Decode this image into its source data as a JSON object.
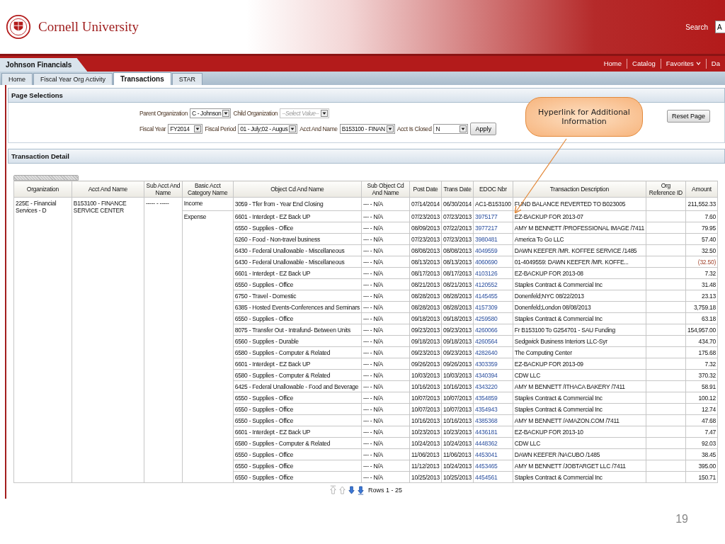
{
  "header": {
    "university": "Cornell University",
    "search_label": "Search",
    "search_value": "A"
  },
  "app_bar": {
    "title": "Johnson Financials",
    "links": [
      {
        "label": "Home",
        "has_menu": false
      },
      {
        "label": "Catalog",
        "has_menu": false
      },
      {
        "label": "Favorites",
        "has_menu": true
      },
      {
        "label": "Da",
        "has_menu": false
      }
    ]
  },
  "tabs": [
    {
      "label": "Home",
      "selected": false
    },
    {
      "label": "Fiscal Year Org Activity",
      "selected": false
    },
    {
      "label": "Transactions",
      "selected": true
    },
    {
      "label": "STAR",
      "selected": false
    }
  ],
  "page_selections": {
    "title": "Page Selections",
    "rows": [
      [
        {
          "label": "Parent Organization",
          "value": "C - Johnson",
          "disabled": false
        },
        {
          "label": "Child Organization",
          "placeholder": "--Select Value--",
          "disabled": true
        }
      ],
      [
        {
          "label": "Fiscal Year",
          "value": "FY2014",
          "disabled": false
        },
        {
          "label": "Fiscal Period",
          "value": "01 - July;02 - Augus",
          "disabled": false
        },
        {
          "label": "Acct And Name",
          "value": "B153100 - FINAN",
          "disabled": false
        },
        {
          "label": "Acct Is Closed",
          "value": "N",
          "disabled": false
        }
      ]
    ],
    "apply": "Apply",
    "reset": "Reset Page"
  },
  "callout": {
    "text": "Hyperlink for Additional Information"
  },
  "transaction_detail": {
    "title": "Transaction Detail",
    "columns": [
      "Organization",
      "Acct And Name",
      "Sub Acct And Name",
      "Basic Acct Category Name",
      "Object Cd And Name",
      "Sub Object Cd And Name",
      "Post Date",
      "Trans Date",
      "EDOC Nbr",
      "Transaction Description",
      "Org Reference ID",
      "Amount"
    ],
    "organization": "225E - Financial Services - D",
    "acct": "B153100 - FINANCE SERVICE CENTER",
    "sub_acct": "----- - -----",
    "groups": [
      {
        "category": "Income",
        "rows": [
          {
            "object": "3059 - Tfer from - Year End Closing",
            "sub_object": "--- - N/A",
            "post_date": "07/14/2014",
            "trans_date": "06/30/2014",
            "edoc": "AC1-B153100",
            "edoc_link": false,
            "description": "FUND BALANCE REVERTED TO B023005",
            "amount": "211,552.33",
            "negative": false
          }
        ]
      },
      {
        "category": "Expense",
        "rows": [
          {
            "object": "6601 - Interdept - EZ Back UP",
            "sub_object": "--- - N/A",
            "post_date": "07/23/2013",
            "trans_date": "07/23/2013",
            "edoc": "3975177",
            "edoc_link": true,
            "description": "EZ-BACKUP FOR 2013-07",
            "amount": "7.60",
            "negative": false
          },
          {
            "object": "6550 - Supplies - Office",
            "sub_object": "--- - N/A",
            "post_date": "08/09/2013",
            "trans_date": "07/22/2013",
            "edoc": "3977217",
            "edoc_link": true,
            "description": "AMY M BENNETT /PROFESSIONAL IMAGE /7411",
            "amount": "79.95",
            "negative": false
          },
          {
            "object": "6260 - Food - Non-travel business",
            "sub_object": "--- - N/A",
            "post_date": "07/23/2013",
            "trans_date": "07/23/2013",
            "edoc": "3980481",
            "edoc_link": true,
            "description": "America To Go LLC",
            "amount": "57.40",
            "negative": false
          },
          {
            "object": "6430 - Federal Unallowable - Miscellaneous",
            "sub_object": "--- - N/A",
            "post_date": "08/08/2013",
            "trans_date": "08/08/2013",
            "edoc": "4049559",
            "edoc_link": true,
            "description": "DAWN KEEFER /MR. KOFFEE SERVICE /1485",
            "amount": "32.50",
            "negative": false
          },
          {
            "object": "6430 - Federal Unallowable - Miscellaneous",
            "sub_object": "--- - N/A",
            "post_date": "08/13/2013",
            "trans_date": "08/13/2013",
            "edoc": "4060690",
            "edoc_link": true,
            "description": "01-4049559: DAWN KEEFER /MR. KOFFE...",
            "amount": "(32.50)",
            "negative": true
          },
          {
            "object": "6601 - Interdept - EZ Back UP",
            "sub_object": "--- - N/A",
            "post_date": "08/17/2013",
            "trans_date": "08/17/2013",
            "edoc": "4103126",
            "edoc_link": true,
            "description": "EZ-BACKUP FOR 2013-08",
            "amount": "7.32",
            "negative": false
          },
          {
            "object": "6550 - Supplies - Office",
            "sub_object": "--- - N/A",
            "post_date": "08/21/2013",
            "trans_date": "08/21/2013",
            "edoc": "4120552",
            "edoc_link": true,
            "description": "Staples Contract & Commercial Inc",
            "amount": "31.48",
            "negative": false
          },
          {
            "object": "6750 - Travel - Domestic",
            "sub_object": "--- - N/A",
            "post_date": "08/28/2013",
            "trans_date": "08/28/2013",
            "edoc": "4145455",
            "edoc_link": true,
            "description": "Donenfeld;NYC 08/22/2013",
            "amount": "23.13",
            "negative": false
          },
          {
            "object": "6385 - Hosted Events-Conferences and Seminars",
            "sub_object": "--- - N/A",
            "post_date": "08/28/2013",
            "trans_date": "08/28/2013",
            "edoc": "4157309",
            "edoc_link": true,
            "description": "Donenfeld;London 08/08/2013",
            "amount": "3,759.18",
            "negative": false
          },
          {
            "object": "6550 - Supplies - Office",
            "sub_object": "--- - N/A",
            "post_date": "09/18/2013",
            "trans_date": "09/18/2013",
            "edoc": "4259580",
            "edoc_link": true,
            "description": "Staples Contract & Commercial Inc",
            "amount": "63.18",
            "negative": false
          },
          {
            "object": "8075 - Transfer Out - Intrafund- Between Units",
            "sub_object": "--- - N/A",
            "post_date": "09/23/2013",
            "trans_date": "09/23/2013",
            "edoc": "4260066",
            "edoc_link": true,
            "description": "Fr B153100 To G254701 - SAU Funding",
            "amount": "154,957.00",
            "negative": false
          },
          {
            "object": "6560 - Supplies - Durable",
            "sub_object": "--- - N/A",
            "post_date": "09/18/2013",
            "trans_date": "09/18/2013",
            "edoc": "4260564",
            "edoc_link": true,
            "description": "Sedgwick Business Interiors LLC-Syr",
            "amount": "434.70",
            "negative": false
          },
          {
            "object": "6580 - Supplies - Computer & Related",
            "sub_object": "--- - N/A",
            "post_date": "09/23/2013",
            "trans_date": "09/23/2013",
            "edoc": "4282640",
            "edoc_link": true,
            "description": "The Computing Center",
            "amount": "175.68",
            "negative": false
          },
          {
            "object": "6601 - Interdept - EZ Back UP",
            "sub_object": "--- - N/A",
            "post_date": "09/26/2013",
            "trans_date": "09/26/2013",
            "edoc": "4303359",
            "edoc_link": true,
            "description": "EZ-BACKUP FOR 2013-09",
            "amount": "7.32",
            "negative": false
          },
          {
            "object": "6580 - Supplies - Computer & Related",
            "sub_object": "--- - N/A",
            "post_date": "10/03/2013",
            "trans_date": "10/03/2013",
            "edoc": "4340394",
            "edoc_link": true,
            "description": "CDW LLC",
            "amount": "370.32",
            "negative": false
          },
          {
            "object": "6425 - Federal Unallowable - Food and Beverage",
            "sub_object": "--- - N/A",
            "post_date": "10/16/2013",
            "trans_date": "10/16/2013",
            "edoc": "4343220",
            "edoc_link": true,
            "description": "AMY M BENNETT /ITHACA BAKERY /7411",
            "amount": "58.91",
            "negative": false
          },
          {
            "object": "6550 - Supplies - Office",
            "sub_object": "--- - N/A",
            "post_date": "10/07/2013",
            "trans_date": "10/07/2013",
            "edoc": "4354859",
            "edoc_link": true,
            "description": "Staples Contract & Commercial Inc",
            "amount": "100.12",
            "negative": false
          },
          {
            "object": "6550 - Supplies - Office",
            "sub_object": "--- - N/A",
            "post_date": "10/07/2013",
            "trans_date": "10/07/2013",
            "edoc": "4354943",
            "edoc_link": true,
            "description": "Staples Contract & Commercial Inc",
            "amount": "12.74",
            "negative": false
          },
          {
            "object": "6550 - Supplies - Office",
            "sub_object": "--- - N/A",
            "post_date": "10/16/2013",
            "trans_date": "10/16/2013",
            "edoc": "4385368",
            "edoc_link": true,
            "description": "AMY M BENNETT /AMAZON.COM /7411",
            "amount": "47.68",
            "negative": false
          },
          {
            "object": "6601 - Interdept - EZ Back UP",
            "sub_object": "--- - N/A",
            "post_date": "10/23/2013",
            "trans_date": "10/23/2013",
            "edoc": "4436181",
            "edoc_link": true,
            "description": "EZ-BACKUP FOR 2013-10",
            "amount": "7.47",
            "negative": false
          },
          {
            "object": "6580 - Supplies - Computer & Related",
            "sub_object": "--- - N/A",
            "post_date": "10/24/2013",
            "trans_date": "10/24/2013",
            "edoc": "4448362",
            "edoc_link": true,
            "description": "CDW LLC",
            "amount": "92.03",
            "negative": false
          },
          {
            "object": "6550 - Supplies - Office",
            "sub_object": "--- - N/A",
            "post_date": "11/06/2013",
            "trans_date": "11/06/2013",
            "edoc": "4453041",
            "edoc_link": true,
            "description": "DAWN KEEFER /NACUBO /1485",
            "amount": "38.45",
            "negative": false
          },
          {
            "object": "6550 - Supplies - Office",
            "sub_object": "--- - N/A",
            "post_date": "11/12/2013",
            "trans_date": "10/24/2013",
            "edoc": "4453465",
            "edoc_link": true,
            "description": "AMY M BENNETT /JOBTARGET LLC /7411",
            "amount": "395.00",
            "negative": false
          },
          {
            "object": "6550 - Supplies - Office",
            "sub_object": "--- - N/A",
            "post_date": "10/25/2013",
            "trans_date": "10/25/2013",
            "edoc": "4454561",
            "edoc_link": true,
            "description": "Staples Contract & Commercial Inc",
            "amount": "150.71",
            "negative": false
          }
        ]
      }
    ],
    "pager": {
      "buttons": [
        {
          "kind": "first",
          "enabled": false
        },
        {
          "kind": "prev",
          "enabled": false
        },
        {
          "kind": "next",
          "enabled": true
        },
        {
          "kind": "last",
          "enabled": true
        }
      ],
      "rows_label": "Rows 1 - 25"
    }
  },
  "slide_number": "19"
}
